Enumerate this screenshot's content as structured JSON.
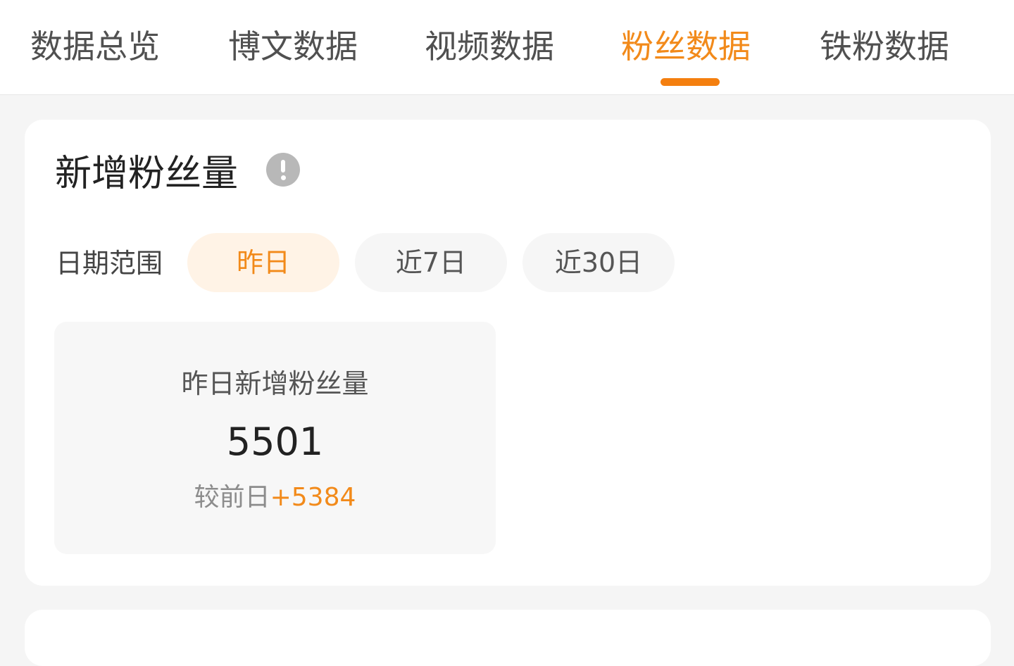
{
  "colors": {
    "accent": "#f28a1a",
    "active_pill_bg": "#fff3e6",
    "page_bg": "#f5f5f5"
  },
  "tabs": [
    {
      "label": "数据总览",
      "active": false
    },
    {
      "label": "博文数据",
      "active": false
    },
    {
      "label": "视频数据",
      "active": false
    },
    {
      "label": "粉丝数据",
      "active": true
    },
    {
      "label": "铁粉数据",
      "active": false
    }
  ],
  "card": {
    "title": "新增粉丝量",
    "info_icon": "info-exclamation-icon",
    "date_range": {
      "label": "日期范围",
      "options": [
        {
          "label": "昨日",
          "selected": true
        },
        {
          "label": "近7日",
          "selected": false
        },
        {
          "label": "近30日",
          "selected": false
        }
      ]
    },
    "stat": {
      "label": "昨日新增粉丝量",
      "value": "5501",
      "compare_label": "较前日",
      "compare_value": "+5384"
    }
  }
}
